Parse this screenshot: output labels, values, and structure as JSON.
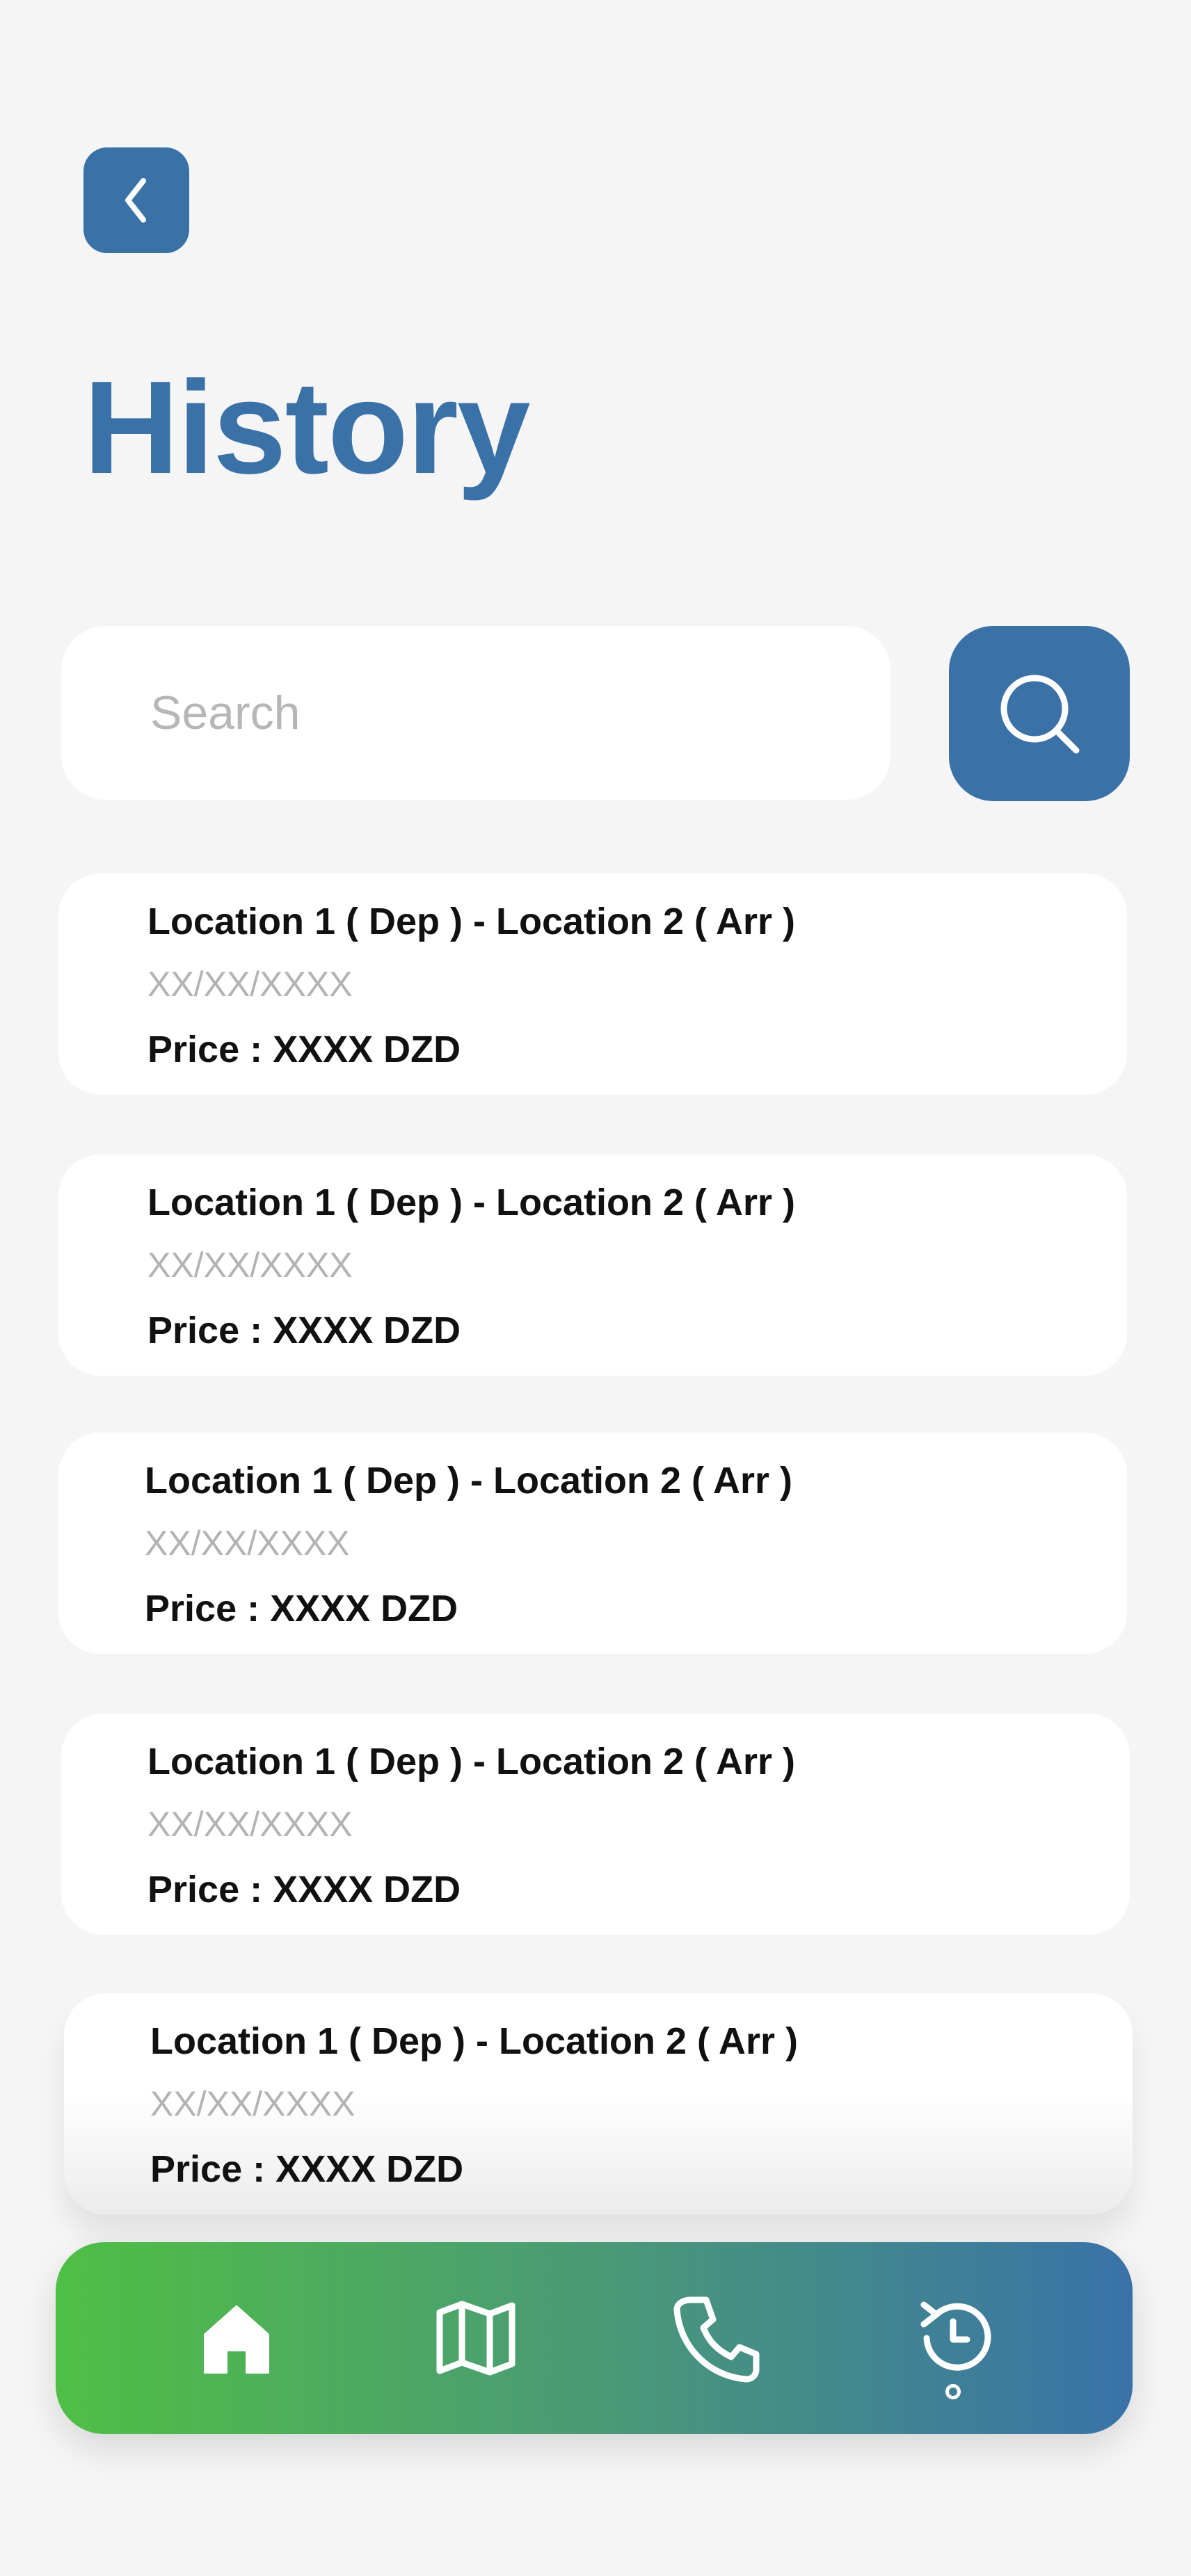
{
  "header": {
    "back_icon": "chevron-left-icon",
    "title": "History"
  },
  "search": {
    "placeholder": "Search",
    "value": "",
    "button_icon": "search-icon"
  },
  "history": [
    {
      "route": "Location 1 ( Dep ) - Location 2 ( Arr )",
      "date": "XX/XX/XXXX",
      "price": "Price : XXXX DZD"
    },
    {
      "route": "Location 1 ( Dep ) - Location 2 ( Arr )",
      "date": "XX/XX/XXXX",
      "price": "Price : XXXX DZD"
    },
    {
      "route": "Location 1 ( Dep ) - Location 2 ( Arr )",
      "date": "XX/XX/XXXX",
      "price": "Price : XXXX DZD"
    },
    {
      "route": "Location 1 ( Dep ) - Location 2 ( Arr )",
      "date": "XX/XX/XXXX",
      "price": "Price : XXXX DZD"
    },
    {
      "route": "Location 1 ( Dep ) - Location 2 ( Arr )",
      "date": "XX/XX/XXXX",
      "price": "Price : XXXX DZD"
    }
  ],
  "nav": {
    "items": [
      "home-icon",
      "map-icon",
      "phone-icon",
      "history-icon"
    ],
    "active": "history-icon"
  },
  "colors": {
    "primary": "#3a72a8",
    "gradient_start": "#4fbf45",
    "gradient_end": "#3a72a8",
    "background": "#f5f5f6"
  }
}
